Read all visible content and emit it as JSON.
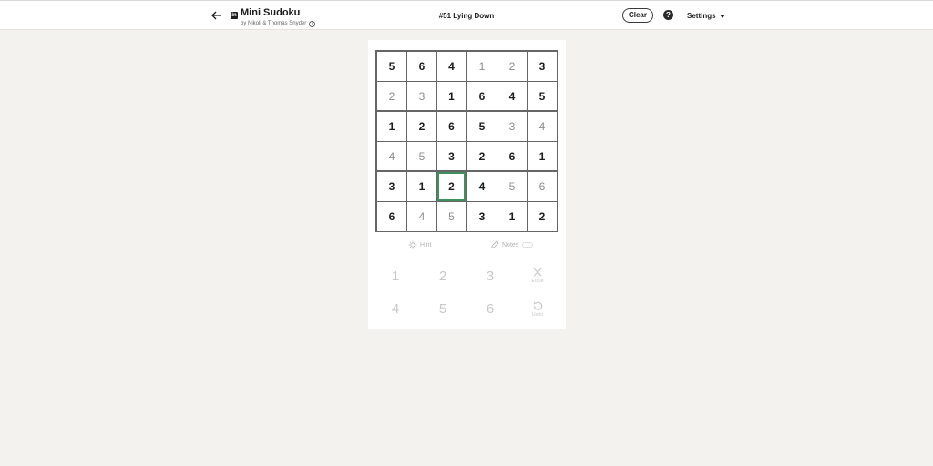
{
  "header": {
    "game_title": "Mini Sudoku",
    "byline": "by Nikoli & Thomas Snyder",
    "puzzle_title": "#51 Lying Down",
    "clear_label": "Clear",
    "help_label": "?",
    "settings_label": "Settings",
    "logo_text": "in"
  },
  "icons": {
    "back": "arrow-left-icon",
    "info": "info-icon",
    "hint": "lightbulb-icon",
    "notes": "pencil-icon",
    "erase": "x-icon",
    "undo": "undo-icon"
  },
  "board": {
    "size": 6,
    "cells": [
      [
        {
          "v": "5",
          "given": true
        },
        {
          "v": "6",
          "given": true
        },
        {
          "v": "4",
          "given": true
        },
        {
          "v": "1",
          "given": false
        },
        {
          "v": "2",
          "given": false
        },
        {
          "v": "3",
          "given": true
        }
      ],
      [
        {
          "v": "2",
          "given": false
        },
        {
          "v": "3",
          "given": false
        },
        {
          "v": "1",
          "given": true
        },
        {
          "v": "6",
          "given": true
        },
        {
          "v": "4",
          "given": true
        },
        {
          "v": "5",
          "given": true
        }
      ],
      [
        {
          "v": "1",
          "given": true
        },
        {
          "v": "2",
          "given": true
        },
        {
          "v": "6",
          "given": true
        },
        {
          "v": "5",
          "given": true
        },
        {
          "v": "3",
          "given": false
        },
        {
          "v": "4",
          "given": false
        }
      ],
      [
        {
          "v": "4",
          "given": false
        },
        {
          "v": "5",
          "given": false
        },
        {
          "v": "3",
          "given": true
        },
        {
          "v": "2",
          "given": true
        },
        {
          "v": "6",
          "given": true
        },
        {
          "v": "1",
          "given": true
        }
      ],
      [
        {
          "v": "3",
          "given": true
        },
        {
          "v": "1",
          "given": true
        },
        {
          "v": "2",
          "given": true
        },
        {
          "v": "4",
          "given": true
        },
        {
          "v": "5",
          "given": false
        },
        {
          "v": "6",
          "given": false
        }
      ],
      [
        {
          "v": "6",
          "given": true
        },
        {
          "v": "4",
          "given": false
        },
        {
          "v": "5",
          "given": false
        },
        {
          "v": "3",
          "given": true
        },
        {
          "v": "1",
          "given": true
        },
        {
          "v": "2",
          "given": true
        }
      ]
    ],
    "selected": [
      4,
      2
    ],
    "selected_color": "#3f8f5f"
  },
  "tools": {
    "hint_label": "Hint",
    "notes_label": "Notes"
  },
  "keypad": {
    "numbers": [
      "1",
      "2",
      "3",
      "4",
      "5",
      "6"
    ],
    "erase_label": "Erase",
    "undo_label": "Undo"
  }
}
